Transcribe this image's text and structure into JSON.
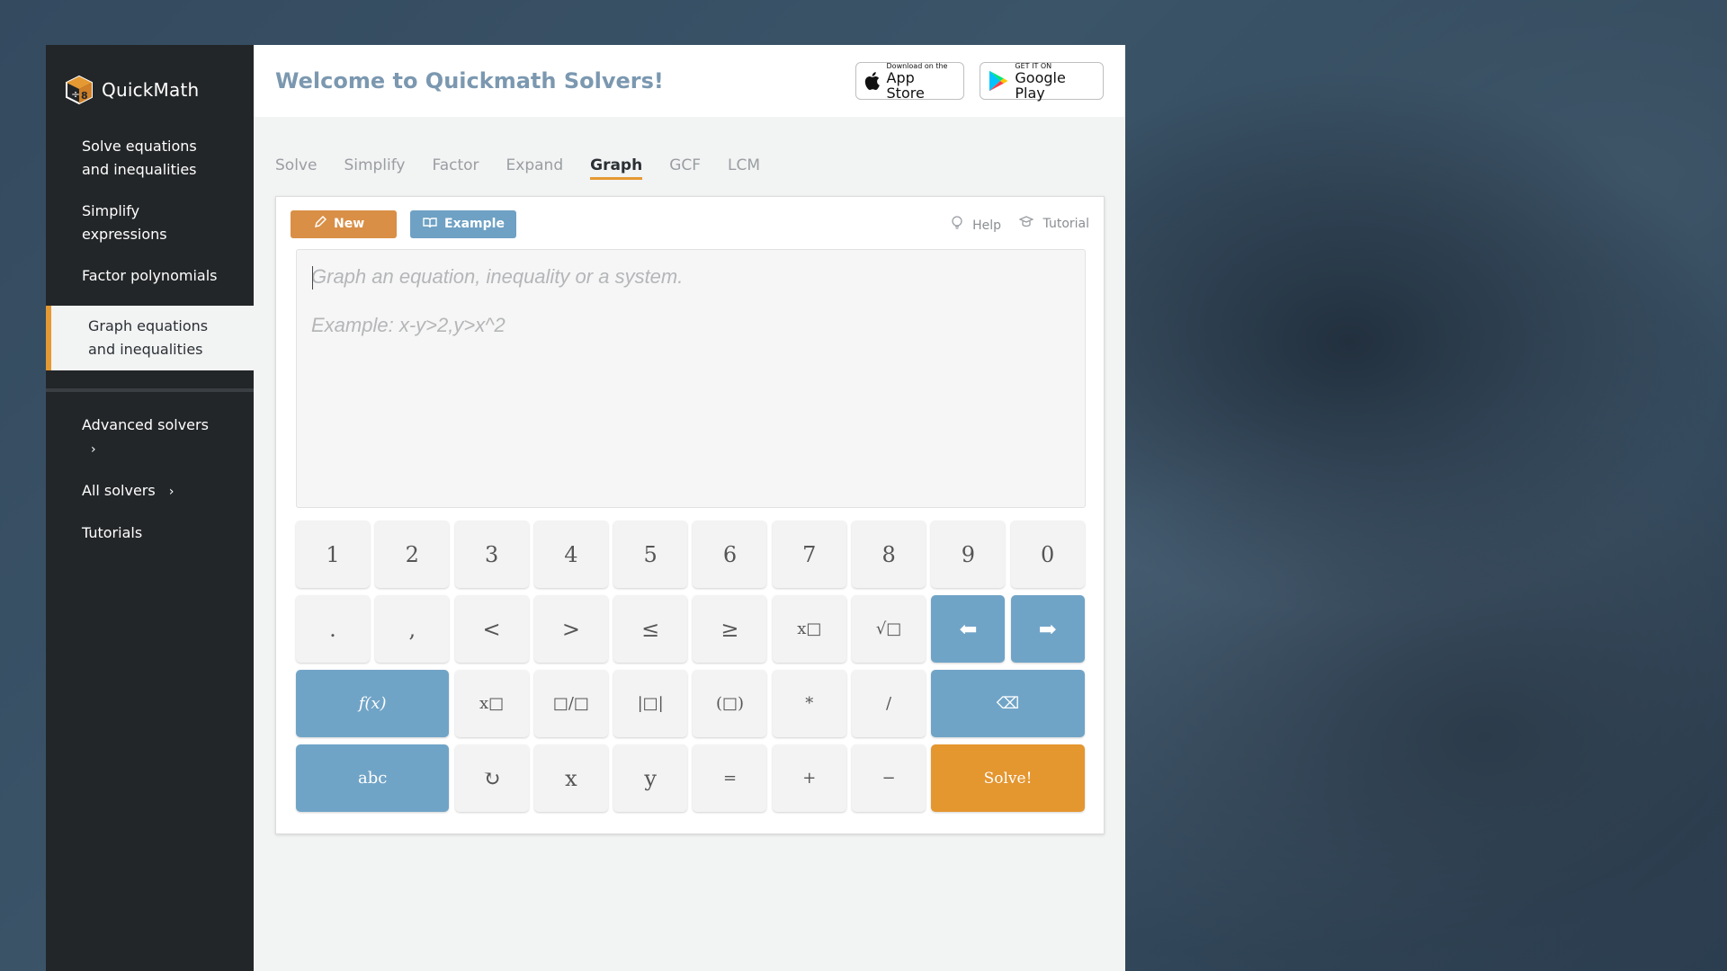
{
  "brand": {
    "name": "QuickMath"
  },
  "sidebar": {
    "items": [
      {
        "label": "Solve equations and inequalities"
      },
      {
        "label": "Simplify expressions"
      },
      {
        "label": "Factor polynomials"
      },
      {
        "label": "Graph equations and inequalities"
      }
    ],
    "secondary": [
      {
        "label": "Advanced solvers",
        "chevron": "›"
      },
      {
        "label": "All solvers",
        "chevron": "›"
      },
      {
        "label": "Tutorials"
      }
    ]
  },
  "header": {
    "title": "Welcome to Quickmath Solvers!",
    "app_store": {
      "small": "Download on the",
      "big": "App Store"
    },
    "google_play": {
      "small": "GET IT ON",
      "big": "Google Play"
    }
  },
  "tabs": [
    {
      "label": "Solve"
    },
    {
      "label": "Simplify"
    },
    {
      "label": "Factor"
    },
    {
      "label": "Expand"
    },
    {
      "label": "Graph",
      "active": true
    },
    {
      "label": "GCF"
    },
    {
      "label": "LCM"
    }
  ],
  "toolbar": {
    "new_label": "New",
    "example_label": "Example",
    "help_label": "Help",
    "tutorial_label": "Tutorial"
  },
  "editor": {
    "placeholder_line1": "Graph an equation, inequality or a system.",
    "placeholder_line2": "Example: x-y>2,y>x^2"
  },
  "keypad": {
    "row1": [
      "1",
      "2",
      "3",
      "4",
      "5",
      "6",
      "7",
      "8",
      "9",
      "0"
    ],
    "row2": [
      ".",
      ",",
      "<",
      ">",
      "≤",
      "≥",
      "x□",
      "√□",
      "⬅",
      "➡"
    ],
    "row3": [
      "f(x)",
      "x□",
      "□/□",
      "|□|",
      "(□)",
      "*",
      "/",
      "⌫"
    ],
    "row4": [
      "abc",
      "↻",
      "x",
      "y",
      "=",
      "+",
      "−",
      "Solve!"
    ]
  },
  "colors": {
    "accent_orange": "#e4962f",
    "accent_blue": "#70a4c7",
    "sidebar_bg": "#232628"
  }
}
